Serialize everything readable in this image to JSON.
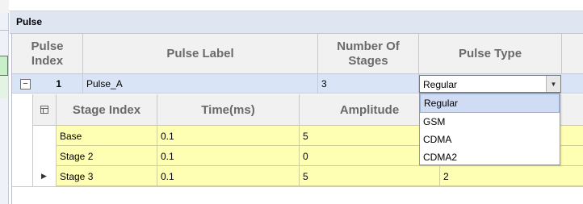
{
  "group": {
    "title": "Pulse"
  },
  "columns": {
    "pulse_index": "Pulse\nIndex",
    "pulse_label": "Pulse Label",
    "number_of_stages": "Number Of\nStages",
    "pulse_type": "Pulse Type"
  },
  "pulse_row": {
    "index": "1",
    "label": "Pulse_A",
    "stages": "3",
    "type": "Regular"
  },
  "sub_columns": {
    "stage_index": "Stage Index",
    "time": "Time(ms)",
    "amplitude": "Amplitude"
  },
  "stages": [
    {
      "name": "Base",
      "time": "0.1",
      "amplitude": "5",
      "extra": ""
    },
    {
      "name": "Stage 2",
      "time": "0.1",
      "amplitude": "0",
      "extra": ""
    },
    {
      "name": "Stage 3",
      "time": "0.1",
      "amplitude": "5",
      "extra": "2"
    }
  ],
  "dropdown_options": [
    "Regular",
    "GSM",
    "CDMA",
    "CDMA2"
  ],
  "icons": {
    "expand": "minus-box-icon",
    "combo": "chevron-down-icon",
    "column_chooser": "column-chooser-icon",
    "row_indicator": "row-pointer-icon"
  }
}
